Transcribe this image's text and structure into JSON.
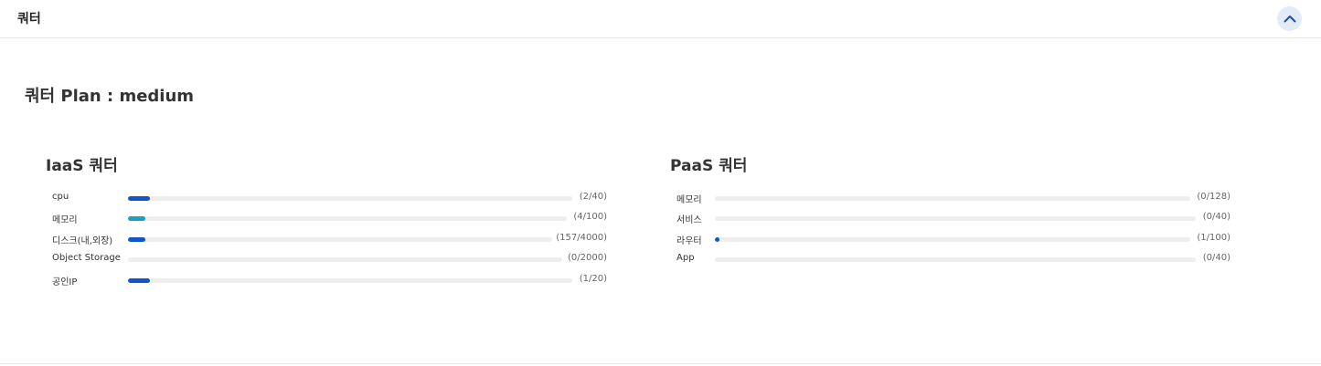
{
  "header": {
    "title": "쿼터"
  },
  "plan": {
    "text": "쿼터 Plan : medium"
  },
  "iaas": {
    "title": "IaaS 쿼터",
    "items": [
      {
        "label": "cpu",
        "value": "(2/40)",
        "ratio": 0.05,
        "color": "#1155cc"
      },
      {
        "label": "메모리",
        "value": "(4/100)",
        "ratio": 0.04,
        "color": "#1a9ec9"
      },
      {
        "label": "디스크(내,외장)",
        "value": "(157/4000)",
        "ratio": 0.04,
        "color": "#1155cc"
      },
      {
        "label": "Object Storage",
        "value": "(0/2000)",
        "ratio": 0,
        "color": "#1155cc"
      },
      {
        "label": "공인IP",
        "value": "(1/20)",
        "ratio": 0.05,
        "color": "#1155cc"
      }
    ]
  },
  "paas": {
    "title": "PaaS 쿼터",
    "items": [
      {
        "label": "메모리",
        "value": "(0/128)",
        "ratio": 0,
        "color": "#1155cc"
      },
      {
        "label": "서비스",
        "value": "(0/40)",
        "ratio": 0,
        "color": "#1155cc"
      },
      {
        "label": "라우터",
        "value": "(1/100)",
        "ratio": 0.01,
        "color": "#1155cc"
      },
      {
        "label": "App",
        "value": "(0/40)",
        "ratio": 0,
        "color": "#1155cc"
      }
    ]
  },
  "icons": {
    "collapse": "chevron-up-icon"
  }
}
